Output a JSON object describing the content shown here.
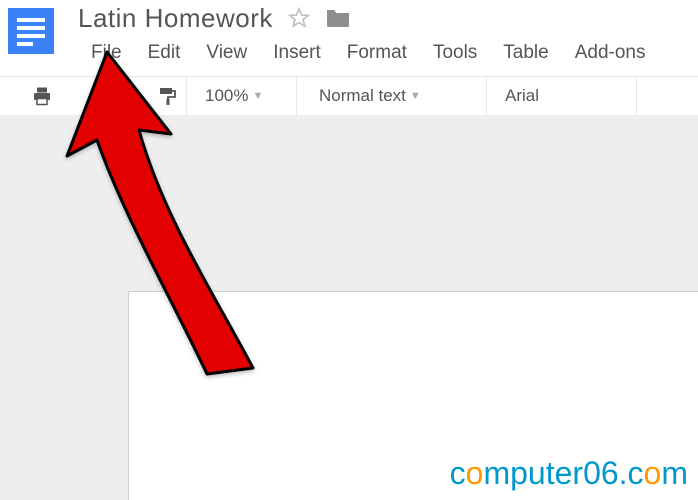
{
  "doc": {
    "title": "Latin Homework"
  },
  "icons": {
    "star": "star-icon",
    "folder": "folder-icon"
  },
  "menubar": {
    "items": [
      "File",
      "Edit",
      "View",
      "Insert",
      "Format",
      "Tools",
      "Table",
      "Add-ons"
    ]
  },
  "toolbar": {
    "zoom": "100%",
    "paragraph_style": "Normal text",
    "font": "Arial"
  },
  "watermark": {
    "text": "computer06.com",
    "c_color": "#0099cc",
    "o_color": "#ff9900"
  }
}
